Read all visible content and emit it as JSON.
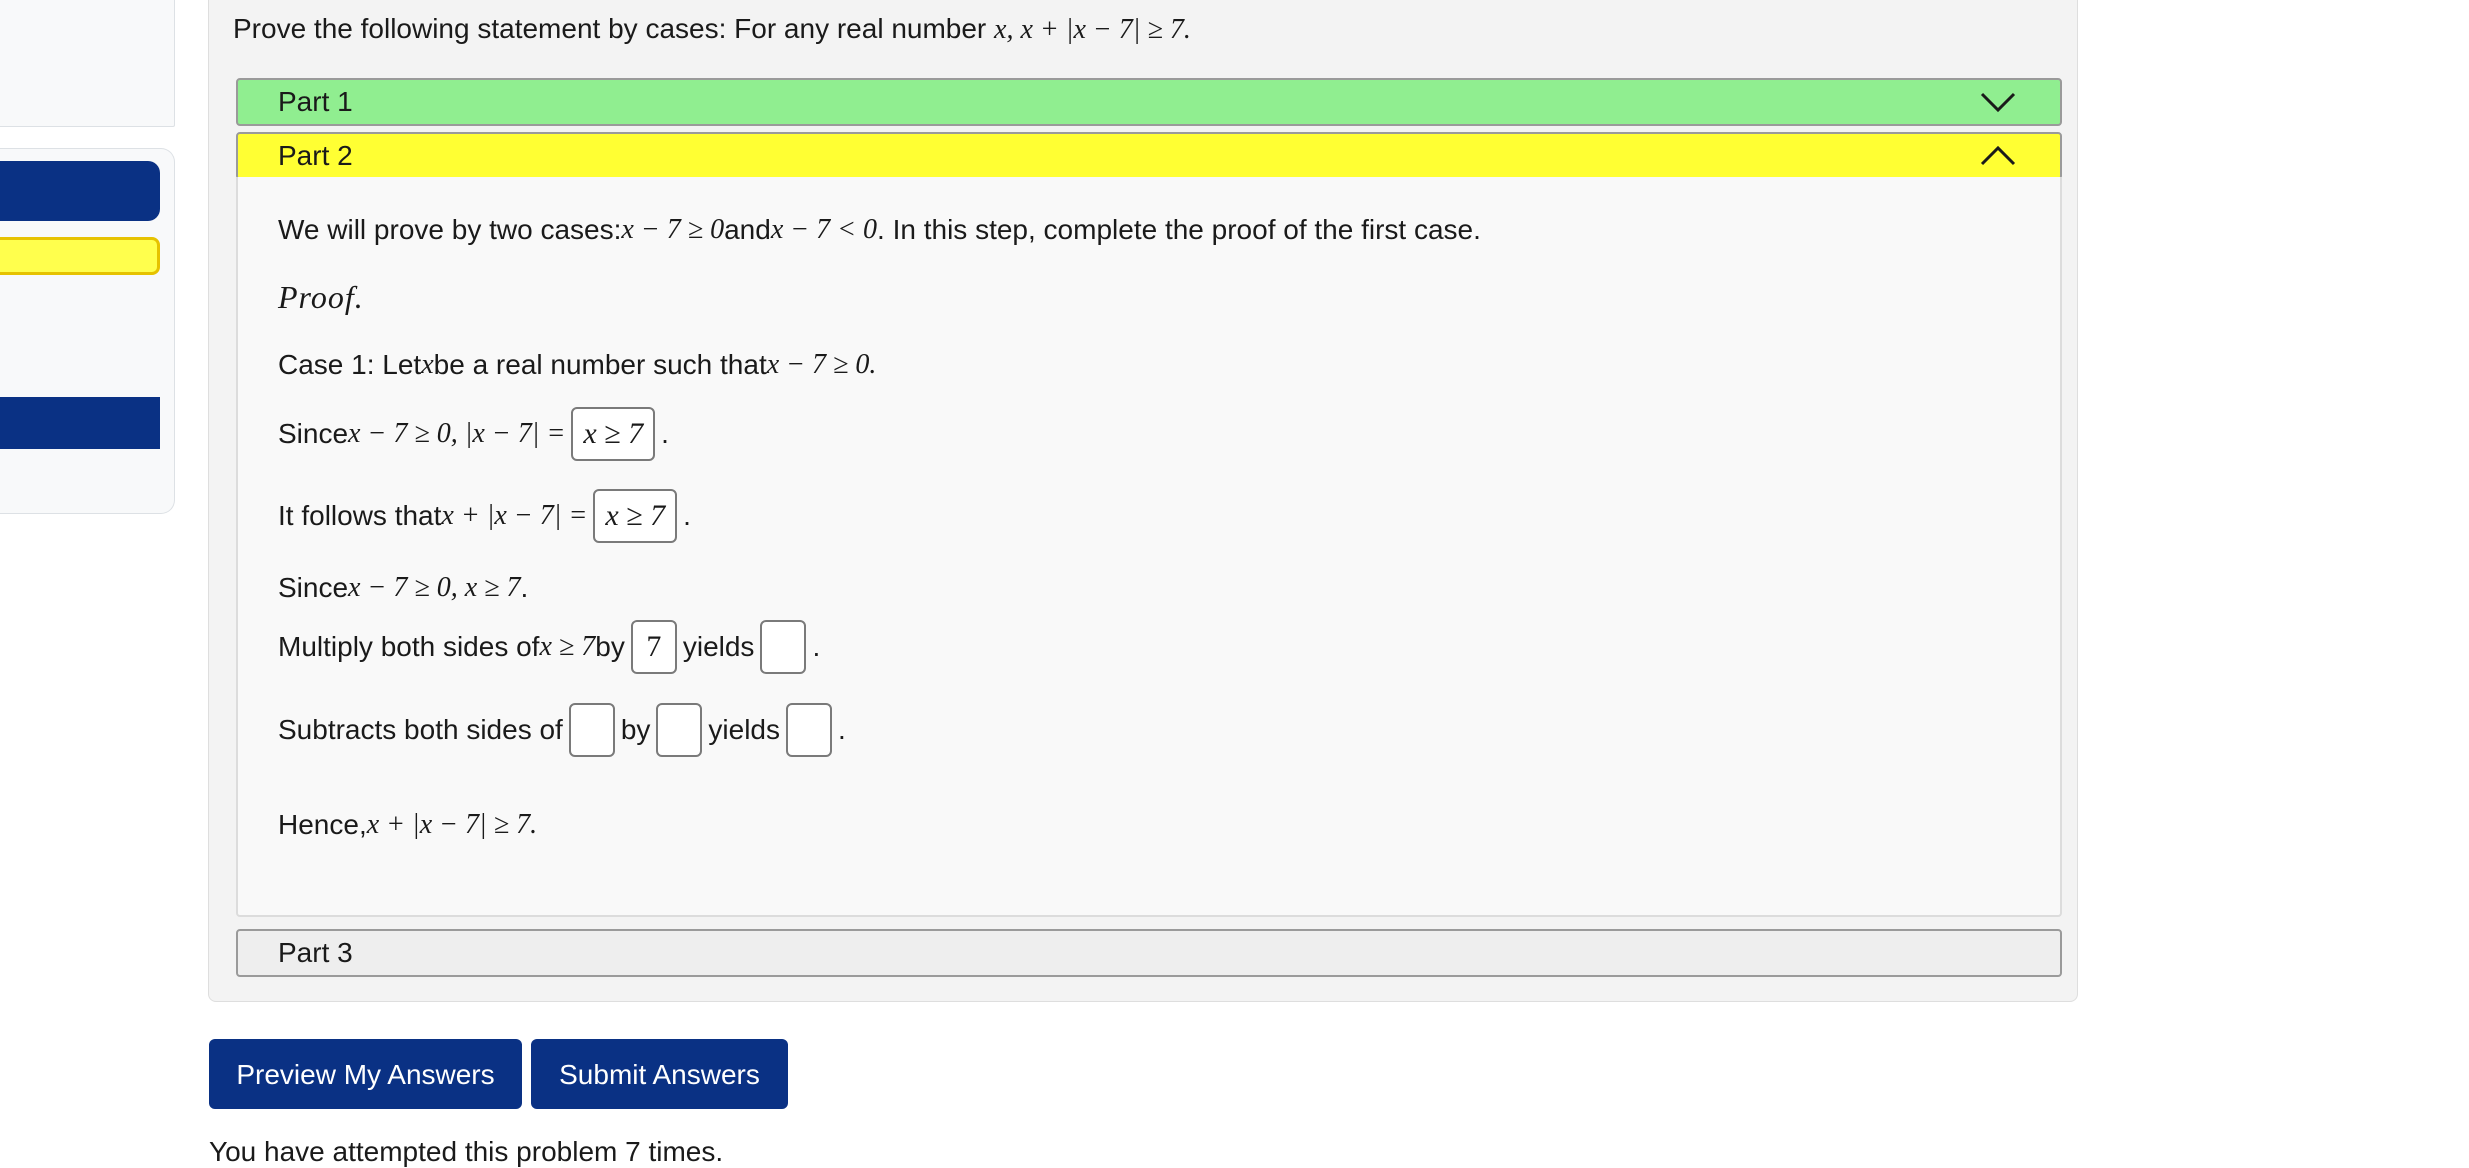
{
  "problem": {
    "statement_prefix": "Prove the following statement by cases: For any real number ",
    "statement_math": "x, x + |x − 7| ≥ 7."
  },
  "parts": [
    {
      "label": "Part 1",
      "state": "collapsed",
      "color": "#90ee90",
      "icon": "chevron-down-icon"
    },
    {
      "label": "Part 2",
      "state": "expanded",
      "color": "#ffff33",
      "icon": "chevron-up-icon"
    },
    {
      "label": "Part 3",
      "state": "collapsed",
      "color": "#eeeeee"
    }
  ],
  "part2": {
    "intro_a": "We will prove by two cases: ",
    "intro_math_1": "x − 7 ≥ 0",
    "intro_b": " and ",
    "intro_math_2": "x − 7 < 0",
    "intro_c": ". In this step, complete the proof of the first case.",
    "proof_label": "Proof.",
    "case1_a": "Case 1: Let ",
    "case1_math_x": "x",
    "case1_b": " be a real number such that ",
    "case1_math": "x − 7 ≥ 0.",
    "since1_a": "Since ",
    "since1_math": "x − 7 ≥ 0, |x − 7| =",
    "since1_answer": "x ≥ 7",
    "follows_a": "It follows that ",
    "follows_math": "x + |x − 7| =",
    "follows_answer": "x ≥ 7",
    "since2_a": "Since ",
    "since2_math": "x − 7 ≥ 0, x ≥ 7",
    "since2_end": " .",
    "multiply_a": "Multiply both sides of ",
    "multiply_math": "x ≥ 7",
    "multiply_b": " by",
    "multiply_answer": "7",
    "multiply_c": "yields",
    "multiply_result": "",
    "subtract_a": "Subtracts both sides of",
    "subtract_answer1": "",
    "subtract_b": "by",
    "subtract_answer2": "",
    "subtract_c": "yields",
    "subtract_result": "",
    "hence_a": "Hence, ",
    "hence_math": "x + |x − 7| ≥ 7."
  },
  "buttons": {
    "preview": "Preview My Answers",
    "submit": "Submit Answers"
  },
  "attempts_text": "You have attempted this problem 7 times.",
  "colors": {
    "primary": "#0a3184",
    "part_correct": "#90ee90",
    "part_active": "#ffff33"
  }
}
